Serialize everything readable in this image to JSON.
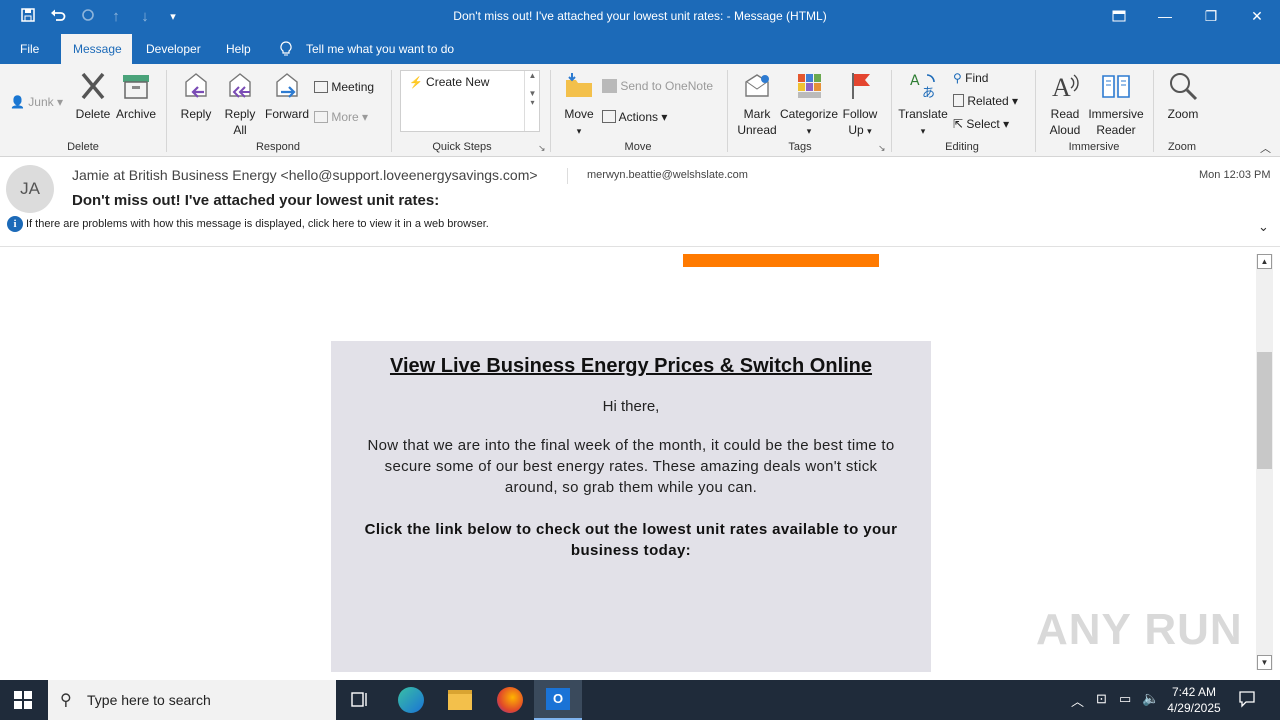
{
  "window": {
    "title": "Don't miss out! I've attached your lowest unit rates:  -  Message (HTML)"
  },
  "menu": {
    "file": "File",
    "message": "Message",
    "developer": "Developer",
    "help": "Help",
    "tell_me": "Tell me what you want to do"
  },
  "ribbon": {
    "junk": "Junk",
    "delete": "Delete",
    "archive": "Archive",
    "group_delete": "Delete",
    "reply": "Reply",
    "reply_all_1": "Reply",
    "reply_all_2": "All",
    "forward": "Forward",
    "meeting": "Meeting",
    "more": "More",
    "group_respond": "Respond",
    "create_new": "Create New",
    "group_quicksteps": "Quick Steps",
    "move": "Move",
    "send_onenote": "Send to OneNote",
    "actions": "Actions",
    "group_move": "Move",
    "mark_unread_1": "Mark",
    "mark_unread_2": "Unread",
    "categorize": "Categorize",
    "follow_up_1": "Follow",
    "follow_up_2": "Up",
    "group_tags": "Tags",
    "translate": "Translate",
    "find": "Find",
    "related": "Related",
    "select": "Select",
    "group_editing": "Editing",
    "read_aloud_1": "Read",
    "read_aloud_2": "Aloud",
    "immersive_1": "Immersive",
    "immersive_2": "Reader",
    "group_immersive": "Immersive",
    "zoom": "Zoom",
    "group_zoom": "Zoom"
  },
  "message": {
    "avatar_initials": "JA",
    "from": "Jamie at British Business Energy <hello@support.loveenergysavings.com>",
    "to": "merwyn.beattie@welshslate.com",
    "date": "Mon 12:03 PM",
    "subject": "Don't miss out! I've attached your lowest unit rates:",
    "info_bar": "If there are problems with how this message is displayed, click here to view it in a web browser."
  },
  "email": {
    "headline": "View Live Business Energy Prices & Switch Online",
    "greeting": "Hi there,",
    "paragraph": "Now that we are into the final week of the month, it could be the best time to secure some of our best energy rates. These amazing deals won't stick around, so grab them while you can.",
    "cta_text": "Click the link below to check out the lowest unit rates available to your business today:"
  },
  "watermark": "ANY RUN",
  "taskbar": {
    "search_placeholder": "Type here to search",
    "time": "7:42 AM",
    "date": "4/29/2025"
  },
  "colors": {
    "titlebar": "#1c6ab8",
    "accent_orange": "#ff7a00",
    "email_panel": "#e2e1e8"
  }
}
